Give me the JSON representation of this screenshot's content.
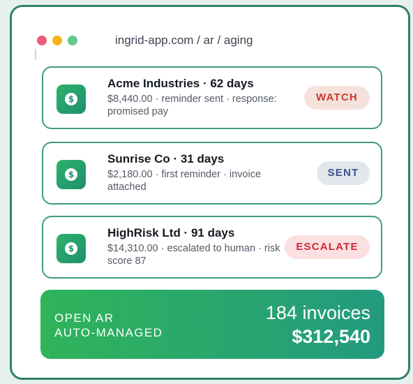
{
  "window": {
    "url": "ingrid-app.com / ar / aging"
  },
  "invoices": [
    {
      "title": "Acme Industries · 62 days",
      "detail": "$8,440.00 · reminder sent · response: promised pay",
      "status": "WATCH",
      "status_color": "#c8392c",
      "icon": "dollar-icon"
    },
    {
      "title": "Sunrise Co · 31 days",
      "detail": "$2,180.00 · first reminder · invoice attached",
      "status": "SENT",
      "status_color": "#37508f",
      "icon": "dollar-icon"
    },
    {
      "title": "HighRisk Ltd · 91 days",
      "detail": "$14,310.00 · escalated to human · risk score 87",
      "status": "ESCALATE",
      "status_color": "#cf2a35",
      "icon": "dollar-icon"
    }
  ],
  "summary": {
    "label_line1": "OPEN AR",
    "label_line2": "AUTO-MANAGED",
    "count": "184 invoices",
    "amount": "$312,540"
  },
  "colors": {
    "accent": "#2fb45a",
    "border": "#2f7f6c"
  }
}
